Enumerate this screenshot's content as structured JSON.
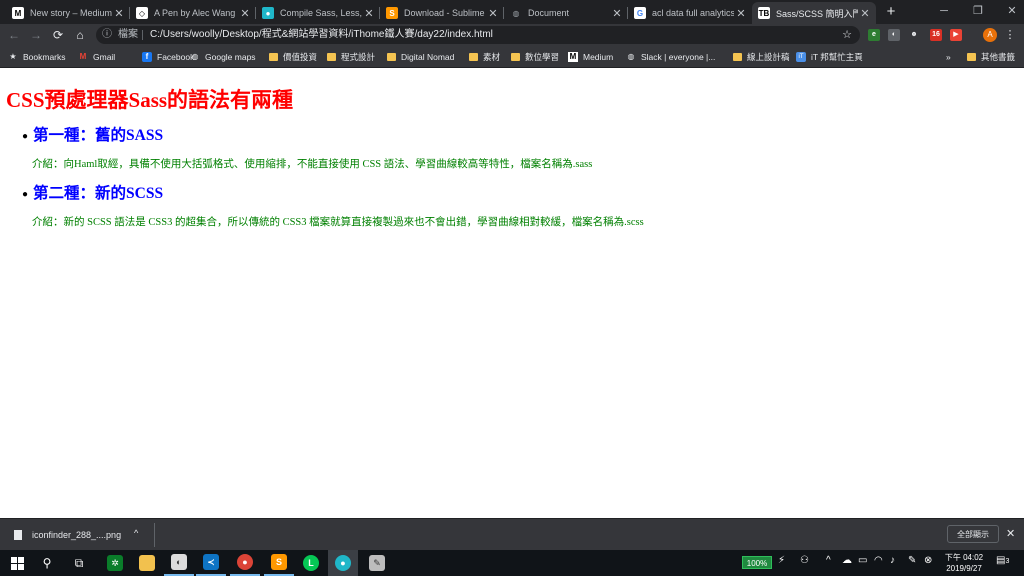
{
  "tabs": [
    {
      "title": "New story – Medium",
      "icon": "medium-icon",
      "icon_char": "M",
      "icon_bg": "#ffffff",
      "icon_fg": "#000000"
    },
    {
      "title": "A Pen by Alec Wang",
      "icon": "codepen-icon",
      "icon_char": "◇",
      "icon_bg": "#ffffff",
      "icon_fg": "#000000"
    },
    {
      "title": "Compile Sass, Less, Ja",
      "icon": "prepros-icon",
      "icon_char": "●",
      "icon_bg": "#1fb7c9",
      "icon_fg": "#ffffff"
    },
    {
      "title": "Download - Sublime",
      "icon": "sublime-icon",
      "icon_char": "S",
      "icon_bg": "#ff9800",
      "icon_fg": "#ffffff"
    },
    {
      "title": "Document",
      "icon": "globe-icon",
      "icon_char": "◍",
      "icon_bg": "transparent",
      "icon_fg": "#9aa0a6"
    },
    {
      "title": "acl data full analytics",
      "icon": "google-icon",
      "icon_char": "G",
      "icon_bg": "#ffffff",
      "icon_fg": "#4285f4"
    },
    {
      "title": "Sass/SCSS 簡明入門教",
      "icon": "tb-icon",
      "icon_char": "TB",
      "icon_bg": "#ffffff",
      "icon_fg": "#000000"
    }
  ],
  "window_controls": {
    "minimize": "─",
    "restore": "❐",
    "close": "✕"
  },
  "omnibox": {
    "scheme_label": "檔案",
    "url": "C:/Users/woolly/Desktop/程式&網站學習資料/iThome鐵人賽/day22/index.html"
  },
  "profile_initial": "A",
  "extension_badge": "16",
  "bookmarks": [
    {
      "label": "Bookmarks",
      "icon": "star-icon",
      "type": "star"
    },
    {
      "label": "Gmail",
      "icon": "gmail-icon",
      "type": "gmail"
    },
    {
      "label": "Facebook",
      "icon": "facebook-icon",
      "type": "facebook"
    },
    {
      "label": "Google maps",
      "icon": "globe-icon",
      "type": "globe"
    },
    {
      "label": "價值投資",
      "icon": "folder-icon",
      "type": "folder"
    },
    {
      "label": "程式設計",
      "icon": "folder-icon",
      "type": "folder"
    },
    {
      "label": "Digital Nomad",
      "icon": "folder-icon",
      "type": "folder"
    },
    {
      "label": "素材",
      "icon": "folder-icon",
      "type": "folder"
    },
    {
      "label": "數位學習",
      "icon": "folder-icon",
      "type": "folder"
    },
    {
      "label": "Medium",
      "icon": "medium-icon",
      "type": "medium"
    },
    {
      "label": "Slack | everyone |...",
      "icon": "globe-icon",
      "type": "globe"
    },
    {
      "label": "線上設計稿",
      "icon": "folder-icon",
      "type": "folder"
    },
    {
      "label": "iT 邦幫忙主頁",
      "icon": "ithelp-icon",
      "type": "ithelp"
    }
  ],
  "other_bookmarks": "其他書籤",
  "page": {
    "heading": "CSS預處理器Sass的語法有兩種",
    "items": [
      {
        "title": "第一種：舊的SASS",
        "desc": "介紹：向Haml取經，具備不使用大括弧格式、使用縮排，不能直接使用 CSS 語法、學習曲線較高等特性，檔案名稱為.sass"
      },
      {
        "title": "第二種：新的SCSS",
        "desc": "介紹：新的 SCSS 語法是 CSS3 的超集合，所以傳統的 CSS3 檔案就算直接複製過來也不會出錯，學習曲線相對較緩，檔案名稱為.scss"
      }
    ]
  },
  "download_shelf": {
    "filename": "iconfinder_288_....png",
    "show_all": "全部顯示"
  },
  "taskbar": {
    "battery": "100%",
    "time": "下午 04:02",
    "date": "2019/9/27",
    "notification_count": "3"
  }
}
